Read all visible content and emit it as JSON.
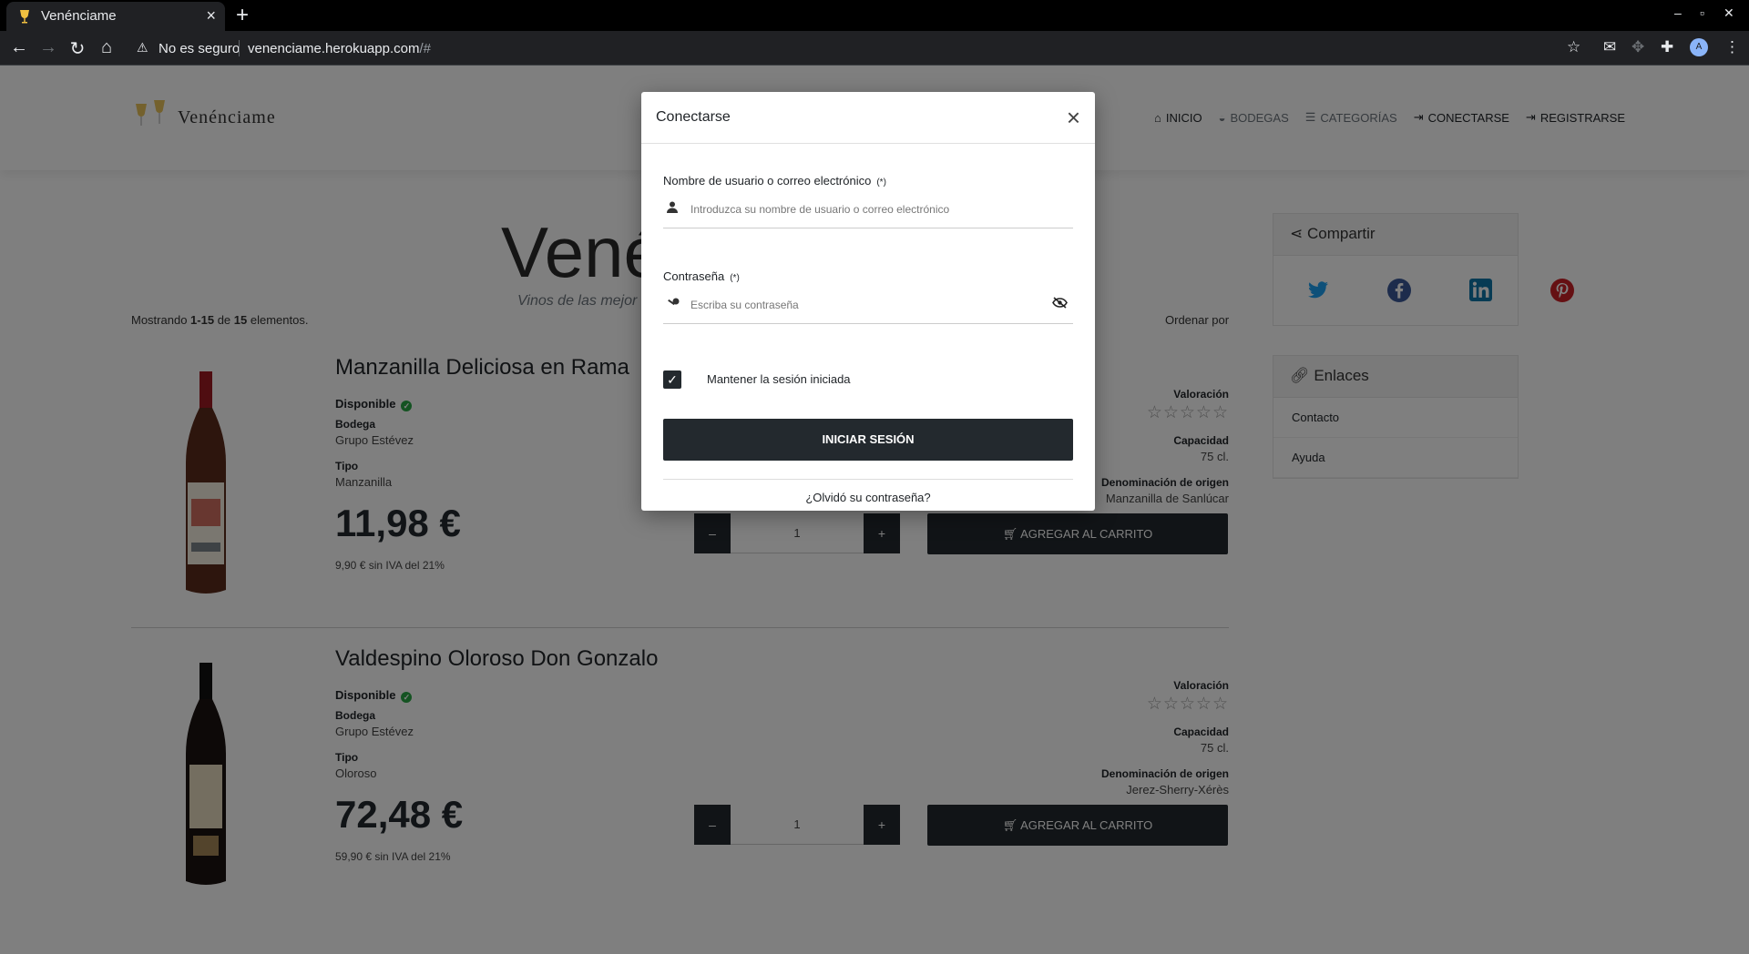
{
  "browser": {
    "tab_title": "Venénciame",
    "security_label": "No es seguro",
    "url_host": "venenciame.herokuapp.com",
    "url_path": "/#"
  },
  "site": {
    "logo_text": "Venénciame",
    "nav": [
      {
        "label": "INICIO",
        "icon": "home-icon"
      },
      {
        "label": "BODEGAS",
        "icon": "wine-barrel-icon"
      },
      {
        "label": "CATEGORÍAS",
        "icon": "list-icon"
      },
      {
        "label": "CONECTARSE",
        "icon": "sign-in-icon"
      },
      {
        "label": "REGISTRARSE",
        "icon": "sign-in-icon"
      }
    ],
    "hero_title": "Vené",
    "hero_subtitle": "Vinos de las mejor",
    "showing": {
      "prefix": "Mostrando ",
      "range": "1-15",
      "mid": " de ",
      "total": "15",
      "suffix": " elementos."
    },
    "sort_label": "Ordenar por"
  },
  "products": [
    {
      "name": "Manzanilla Deliciosa en Rama",
      "availability": "Disponible",
      "winery_label": "Bodega",
      "winery": "Grupo Estévez",
      "type_label": "Tipo",
      "type": "Manzanilla",
      "price": "11,98 €",
      "net_price": "9,90 € sin IVA del 21%",
      "rating_label": "Valoración",
      "rating": 0,
      "capacity_label": "Capacidad",
      "capacity": "75 cl.",
      "origin_label": "Denominación de origen",
      "origin": "Manzanilla de Sanlúcar",
      "quantity": "1",
      "cart_label": "AGREGAR AL CARRITO"
    },
    {
      "name": "Valdespino Oloroso Don Gonzalo",
      "availability": "Disponible",
      "winery_label": "Bodega",
      "winery": "Grupo Estévez",
      "type_label": "Tipo",
      "type": "Oloroso",
      "price": "72,48 €",
      "net_price": "59,90 € sin IVA del 21%",
      "rating_label": "Valoración",
      "rating": 0,
      "capacity_label": "Capacidad",
      "capacity": "75 cl.",
      "origin_label": "Denominación de origen",
      "origin": "Jerez-Sherry-Xérès",
      "quantity": "1",
      "cart_label": "AGREGAR AL CARRITO"
    }
  ],
  "sidebar": {
    "share_title": "Compartir",
    "share_icons": [
      "twitter-icon",
      "facebook-icon",
      "linkedin-icon",
      "pinterest-icon"
    ],
    "share_colors": [
      "#1da1f2",
      "#3b5998",
      "#0e76a8",
      "#cb2027"
    ],
    "links_title": "Enlaces",
    "links": [
      "Contacto",
      "Ayuda"
    ]
  },
  "modal": {
    "title": "Conectarse",
    "username_label": "Nombre de usuario o correo electrónico",
    "required_mark": "(*)",
    "username_placeholder": "Introduzca su nombre de usuario o correo electrónico",
    "password_label": "Contraseña",
    "password_placeholder": "Escriba su contraseña",
    "remember_label": "Mantener la sesión iniciada",
    "remember_checked": true,
    "submit_label": "INICIAR SESIÓN",
    "forgot_label": "¿Olvidó su contraseña?"
  },
  "colors": {
    "primary_dark": "#23292e",
    "available_green": "#28a745"
  }
}
